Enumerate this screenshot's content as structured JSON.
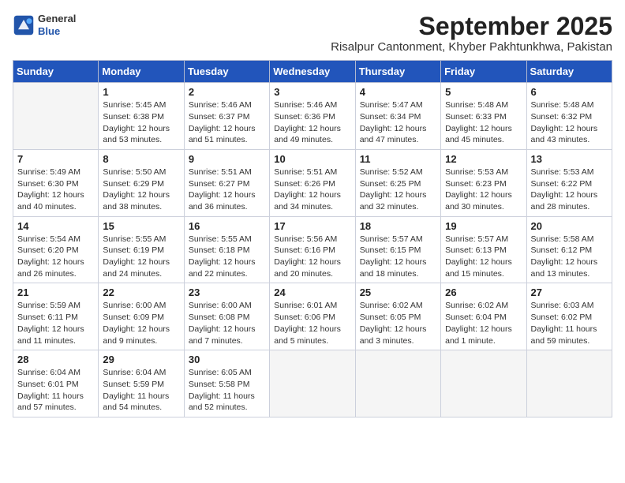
{
  "header": {
    "logo_line1": "General",
    "logo_line2": "Blue",
    "month_year": "September 2025",
    "location": "Risalpur Cantonment, Khyber Pakhtunkhwa, Pakistan"
  },
  "weekdays": [
    "Sunday",
    "Monday",
    "Tuesday",
    "Wednesday",
    "Thursday",
    "Friday",
    "Saturday"
  ],
  "weeks": [
    [
      {
        "day": "",
        "info": ""
      },
      {
        "day": "1",
        "info": "Sunrise: 5:45 AM\nSunset: 6:38 PM\nDaylight: 12 hours\nand 53 minutes."
      },
      {
        "day": "2",
        "info": "Sunrise: 5:46 AM\nSunset: 6:37 PM\nDaylight: 12 hours\nand 51 minutes."
      },
      {
        "day": "3",
        "info": "Sunrise: 5:46 AM\nSunset: 6:36 PM\nDaylight: 12 hours\nand 49 minutes."
      },
      {
        "day": "4",
        "info": "Sunrise: 5:47 AM\nSunset: 6:34 PM\nDaylight: 12 hours\nand 47 minutes."
      },
      {
        "day": "5",
        "info": "Sunrise: 5:48 AM\nSunset: 6:33 PM\nDaylight: 12 hours\nand 45 minutes."
      },
      {
        "day": "6",
        "info": "Sunrise: 5:48 AM\nSunset: 6:32 PM\nDaylight: 12 hours\nand 43 minutes."
      }
    ],
    [
      {
        "day": "7",
        "info": "Sunrise: 5:49 AM\nSunset: 6:30 PM\nDaylight: 12 hours\nand 40 minutes."
      },
      {
        "day": "8",
        "info": "Sunrise: 5:50 AM\nSunset: 6:29 PM\nDaylight: 12 hours\nand 38 minutes."
      },
      {
        "day": "9",
        "info": "Sunrise: 5:51 AM\nSunset: 6:27 PM\nDaylight: 12 hours\nand 36 minutes."
      },
      {
        "day": "10",
        "info": "Sunrise: 5:51 AM\nSunset: 6:26 PM\nDaylight: 12 hours\nand 34 minutes."
      },
      {
        "day": "11",
        "info": "Sunrise: 5:52 AM\nSunset: 6:25 PM\nDaylight: 12 hours\nand 32 minutes."
      },
      {
        "day": "12",
        "info": "Sunrise: 5:53 AM\nSunset: 6:23 PM\nDaylight: 12 hours\nand 30 minutes."
      },
      {
        "day": "13",
        "info": "Sunrise: 5:53 AM\nSunset: 6:22 PM\nDaylight: 12 hours\nand 28 minutes."
      }
    ],
    [
      {
        "day": "14",
        "info": "Sunrise: 5:54 AM\nSunset: 6:20 PM\nDaylight: 12 hours\nand 26 minutes."
      },
      {
        "day": "15",
        "info": "Sunrise: 5:55 AM\nSunset: 6:19 PM\nDaylight: 12 hours\nand 24 minutes."
      },
      {
        "day": "16",
        "info": "Sunrise: 5:55 AM\nSunset: 6:18 PM\nDaylight: 12 hours\nand 22 minutes."
      },
      {
        "day": "17",
        "info": "Sunrise: 5:56 AM\nSunset: 6:16 PM\nDaylight: 12 hours\nand 20 minutes."
      },
      {
        "day": "18",
        "info": "Sunrise: 5:57 AM\nSunset: 6:15 PM\nDaylight: 12 hours\nand 18 minutes."
      },
      {
        "day": "19",
        "info": "Sunrise: 5:57 AM\nSunset: 6:13 PM\nDaylight: 12 hours\nand 15 minutes."
      },
      {
        "day": "20",
        "info": "Sunrise: 5:58 AM\nSunset: 6:12 PM\nDaylight: 12 hours\nand 13 minutes."
      }
    ],
    [
      {
        "day": "21",
        "info": "Sunrise: 5:59 AM\nSunset: 6:11 PM\nDaylight: 12 hours\nand 11 minutes."
      },
      {
        "day": "22",
        "info": "Sunrise: 6:00 AM\nSunset: 6:09 PM\nDaylight: 12 hours\nand 9 minutes."
      },
      {
        "day": "23",
        "info": "Sunrise: 6:00 AM\nSunset: 6:08 PM\nDaylight: 12 hours\nand 7 minutes."
      },
      {
        "day": "24",
        "info": "Sunrise: 6:01 AM\nSunset: 6:06 PM\nDaylight: 12 hours\nand 5 minutes."
      },
      {
        "day": "25",
        "info": "Sunrise: 6:02 AM\nSunset: 6:05 PM\nDaylight: 12 hours\nand 3 minutes."
      },
      {
        "day": "26",
        "info": "Sunrise: 6:02 AM\nSunset: 6:04 PM\nDaylight: 12 hours\nand 1 minute."
      },
      {
        "day": "27",
        "info": "Sunrise: 6:03 AM\nSunset: 6:02 PM\nDaylight: 11 hours\nand 59 minutes."
      }
    ],
    [
      {
        "day": "28",
        "info": "Sunrise: 6:04 AM\nSunset: 6:01 PM\nDaylight: 11 hours\nand 57 minutes."
      },
      {
        "day": "29",
        "info": "Sunrise: 6:04 AM\nSunset: 5:59 PM\nDaylight: 11 hours\nand 54 minutes."
      },
      {
        "day": "30",
        "info": "Sunrise: 6:05 AM\nSunset: 5:58 PM\nDaylight: 11 hours\nand 52 minutes."
      },
      {
        "day": "",
        "info": ""
      },
      {
        "day": "",
        "info": ""
      },
      {
        "day": "",
        "info": ""
      },
      {
        "day": "",
        "info": ""
      }
    ]
  ]
}
